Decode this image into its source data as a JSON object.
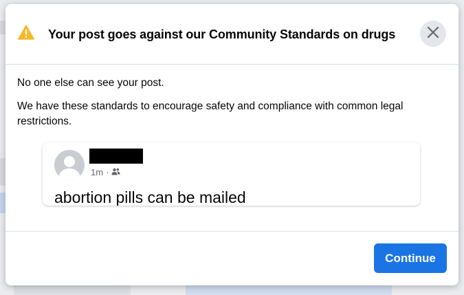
{
  "dialog": {
    "title": "Your post goes against our Community Standards on drugs",
    "warning_icon": "warning-triangle-icon",
    "close_icon": "close-icon",
    "line1": "No one else can see your post.",
    "line2": "We have these standards to encourage safety and compliance with common legal restrictions."
  },
  "post": {
    "time": "1m",
    "separator": "·",
    "audience_icon": "friends-icon",
    "text": "abortion pills can be mailed"
  },
  "footer": {
    "continue_label": "Continue"
  },
  "colors": {
    "primary": "#1b74e4",
    "warning": "#f7b928",
    "text": "#050505",
    "secondary_text": "#65676b"
  }
}
